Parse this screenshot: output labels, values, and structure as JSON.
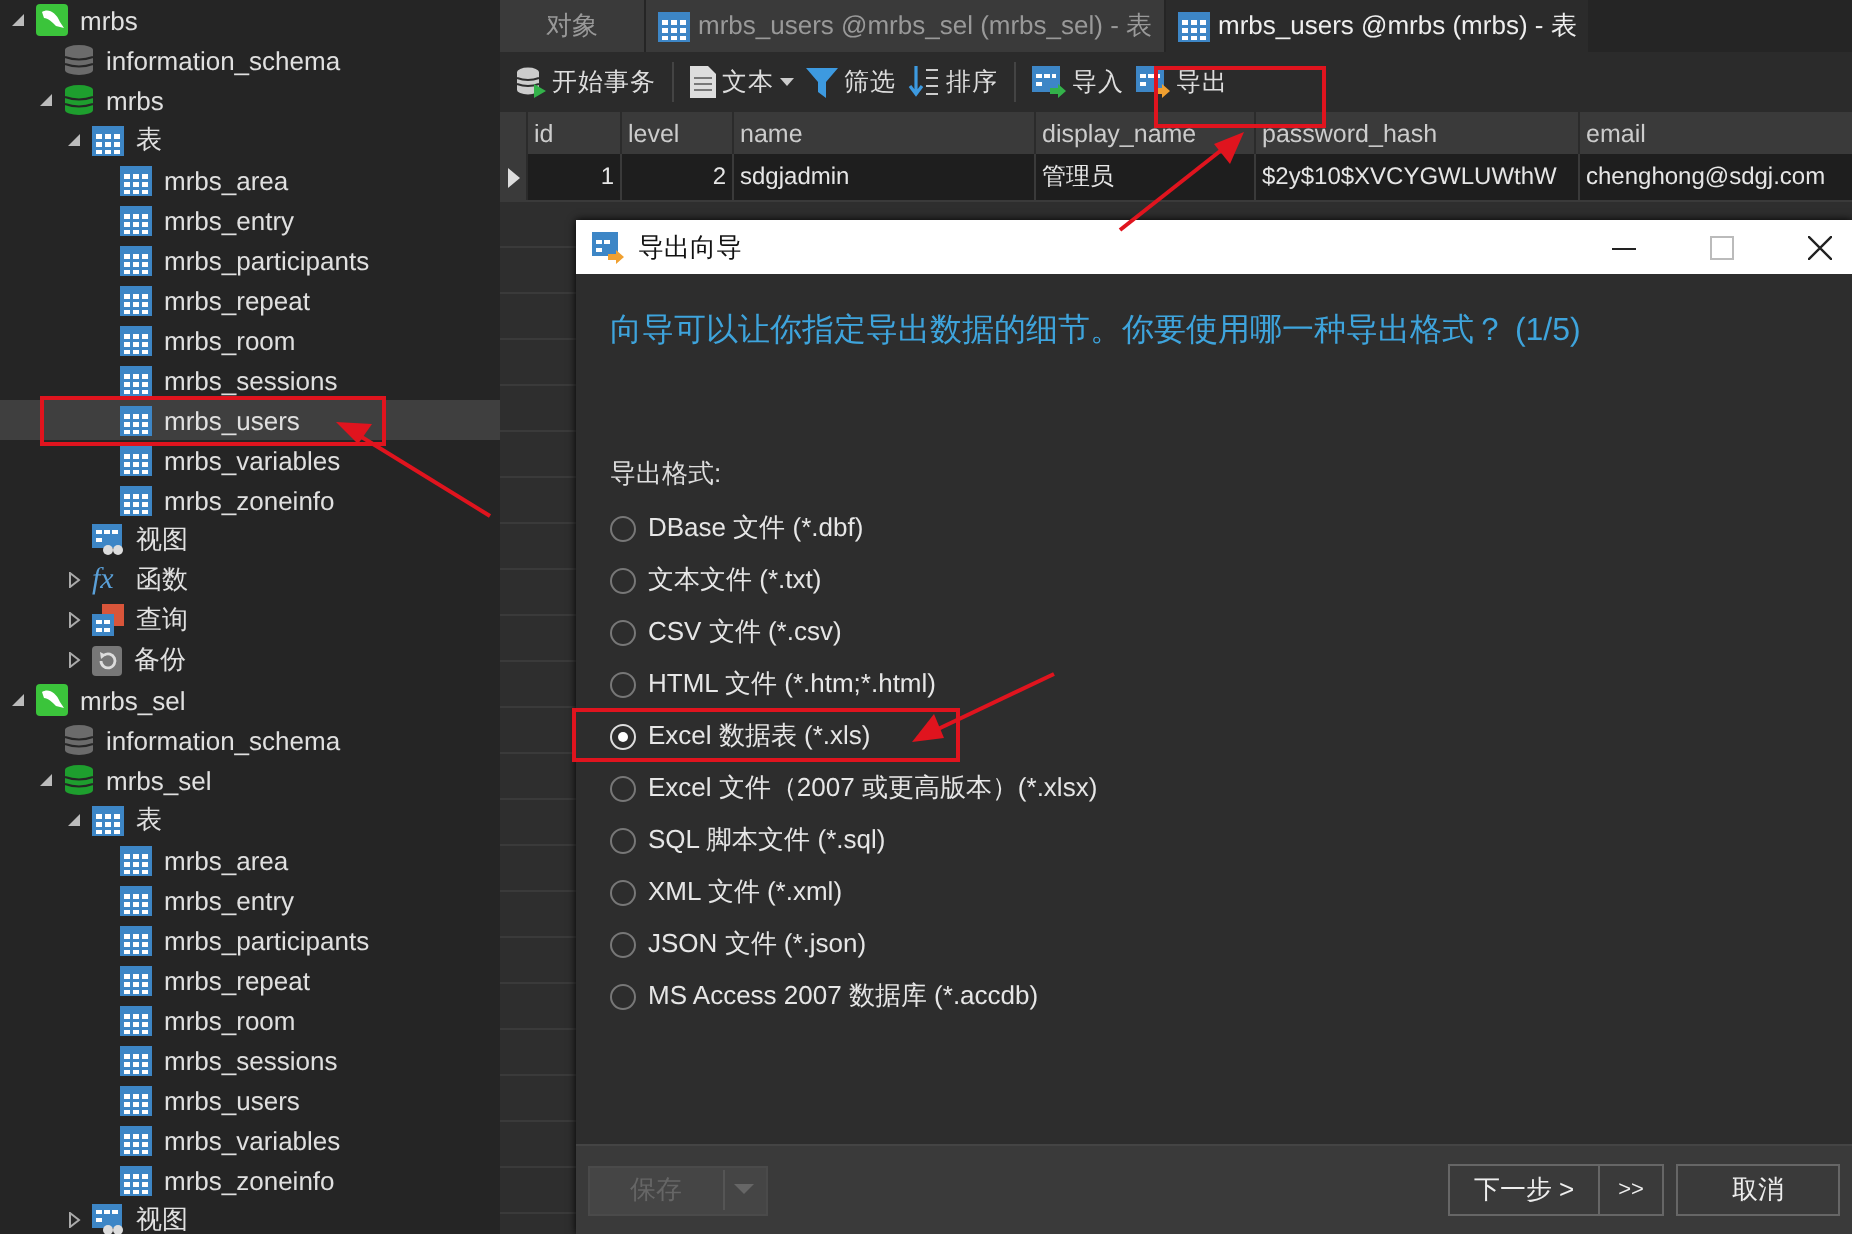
{
  "navigator": {
    "tree": [
      {
        "label": "mrbs",
        "kind": "connection",
        "expanded": true,
        "selected": false,
        "children": [
          {
            "label": "information_schema",
            "kind": "database",
            "open": false,
            "selected": false
          },
          {
            "label": "mrbs",
            "kind": "database",
            "open": true,
            "expanded": true,
            "selected": false,
            "children": [
              {
                "label": "表",
                "kind": "tables",
                "expanded": true,
                "selected": false,
                "children": [
                  {
                    "label": "mrbs_area",
                    "kind": "table",
                    "selected": false
                  },
                  {
                    "label": "mrbs_entry",
                    "kind": "table",
                    "selected": false
                  },
                  {
                    "label": "mrbs_participants",
                    "kind": "table",
                    "selected": false
                  },
                  {
                    "label": "mrbs_repeat",
                    "kind": "table",
                    "selected": false
                  },
                  {
                    "label": "mrbs_room",
                    "kind": "table",
                    "selected": false
                  },
                  {
                    "label": "mrbs_sessions",
                    "kind": "table",
                    "selected": false
                  },
                  {
                    "label": "mrbs_users",
                    "kind": "table",
                    "selected": true
                  },
                  {
                    "label": "mrbs_variables",
                    "kind": "table",
                    "selected": false
                  },
                  {
                    "label": "mrbs_zoneinfo",
                    "kind": "table",
                    "selected": false
                  }
                ]
              },
              {
                "label": "视图",
                "kind": "views",
                "selected": false
              },
              {
                "label": "函数",
                "kind": "functions",
                "icon_text": "fx",
                "expanded": false,
                "selected": false
              },
              {
                "label": "查询",
                "kind": "queries",
                "expanded": false,
                "selected": false
              },
              {
                "label": "备份",
                "kind": "backups",
                "expanded": false,
                "selected": false
              }
            ]
          }
        ]
      },
      {
        "label": "mrbs_sel",
        "kind": "connection",
        "expanded": true,
        "selected": false,
        "children": [
          {
            "label": "information_schema",
            "kind": "database",
            "open": false,
            "selected": false
          },
          {
            "label": "mrbs_sel",
            "kind": "database",
            "open": true,
            "expanded": true,
            "selected": false,
            "children": [
              {
                "label": "表",
                "kind": "tables",
                "expanded": true,
                "selected": false,
                "children": [
                  {
                    "label": "mrbs_area",
                    "kind": "table",
                    "selected": false
                  },
                  {
                    "label": "mrbs_entry",
                    "kind": "table",
                    "selected": false
                  },
                  {
                    "label": "mrbs_participants",
                    "kind": "table",
                    "selected": false
                  },
                  {
                    "label": "mrbs_repeat",
                    "kind": "table",
                    "selected": false
                  },
                  {
                    "label": "mrbs_room",
                    "kind": "table",
                    "selected": false
                  },
                  {
                    "label": "mrbs_sessions",
                    "kind": "table",
                    "selected": false
                  },
                  {
                    "label": "mrbs_users",
                    "kind": "table",
                    "selected": false
                  },
                  {
                    "label": "mrbs_variables",
                    "kind": "table",
                    "selected": false
                  },
                  {
                    "label": "mrbs_zoneinfo",
                    "kind": "table",
                    "selected": false
                  }
                ]
              },
              {
                "label": "视图",
                "kind": "views",
                "expanded": false,
                "selected": false
              }
            ]
          }
        ]
      }
    ]
  },
  "tabs": [
    {
      "label": "对象",
      "kind": "objects",
      "selected": false
    },
    {
      "label": "mrbs_users @mrbs_sel (mrbs_sel) - 表",
      "kind": "table",
      "selected": false
    },
    {
      "label": "mrbs_users @mrbs (mrbs) - 表",
      "kind": "table",
      "selected": true
    }
  ],
  "toolbar": [
    [
      {
        "label": "开始事务",
        "kind": "transaction"
      }
    ],
    [
      {
        "label": "文本",
        "kind": "text",
        "dropdown": true
      },
      {
        "label": "筛选",
        "kind": "filter"
      },
      {
        "label": "排序",
        "kind": "sort"
      }
    ],
    [
      {
        "label": "导入",
        "kind": "import"
      },
      {
        "label": "导出",
        "kind": "export"
      }
    ]
  ],
  "grid": {
    "columns": [
      {
        "label": "id"
      },
      {
        "label": "level"
      },
      {
        "label": "name"
      },
      {
        "label": "display_name"
      },
      {
        "label": "password_hash"
      },
      {
        "label": "email"
      }
    ],
    "rows": [
      {
        "current": true,
        "cells": [
          "1",
          "2",
          "sdgjadmin",
          "管理员",
          "$2y$10$XVCYGWLUWthW",
          "chenghong@sdgj.com"
        ]
      }
    ]
  },
  "dialog": {
    "title": "导出向导",
    "heading": "向导可以让你指定导出数据的细节。你要使用哪一种导出格式？ (1/5)",
    "format_label": "导出格式:",
    "formats": [
      {
        "label": "DBase 文件 (*.dbf)",
        "selected": false
      },
      {
        "label": "文本文件 (*.txt)",
        "selected": false
      },
      {
        "label": "CSV 文件 (*.csv)",
        "selected": false
      },
      {
        "label": "HTML 文件 (*.htm;*.html)",
        "selected": false
      },
      {
        "label": "Excel 数据表 (*.xls)",
        "selected": true
      },
      {
        "label": "Excel 文件（2007 或更高版本）(*.xlsx)",
        "selected": false
      },
      {
        "label": "SQL 脚本文件 (*.sql)",
        "selected": false
      },
      {
        "label": "XML 文件 (*.xml)",
        "selected": false
      },
      {
        "label": "JSON 文件 (*.json)",
        "selected": false
      },
      {
        "label": "MS Access 2007 数据库 (*.accdb)",
        "selected": false
      }
    ],
    "save": {
      "label": "保存",
      "disabled": true
    },
    "next": {
      "label": "下一步 >"
    },
    "skip": {
      "label": ">>"
    },
    "cancel": {
      "label": "取消"
    }
  }
}
